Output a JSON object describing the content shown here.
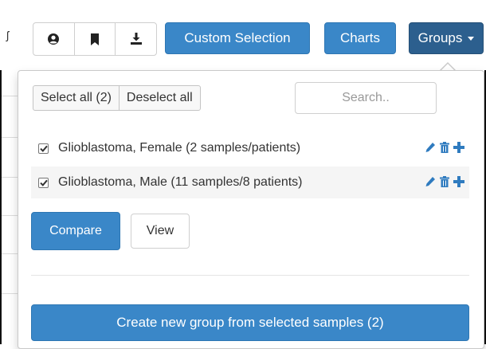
{
  "toolbar": {
    "partial_left_glyph": "ʃ",
    "icon_buttons": [
      {
        "icon": "user-circle-icon"
      },
      {
        "icon": "bookmark-icon"
      },
      {
        "icon": "download-icon"
      }
    ],
    "custom_selection_label": "Custom Selection",
    "charts_label": "Charts",
    "groups_label": "Groups",
    "accent_color": "#3a87c8",
    "active_color": "#2c5f8e"
  },
  "groups_menu": {
    "select_all_label": "Select all (2)",
    "deselect_all_label": "Deselect all",
    "search_placeholder": "Search..",
    "groups": [
      {
        "label": "Glioblastoma, Female (2 samples/patients)",
        "checked": true
      },
      {
        "label": "Glioblastoma, Male (11 samples/8 patients)",
        "checked": true
      }
    ],
    "compare_label": "Compare",
    "view_label": "View",
    "create_group_label": "Create new group from selected samples (2)"
  }
}
